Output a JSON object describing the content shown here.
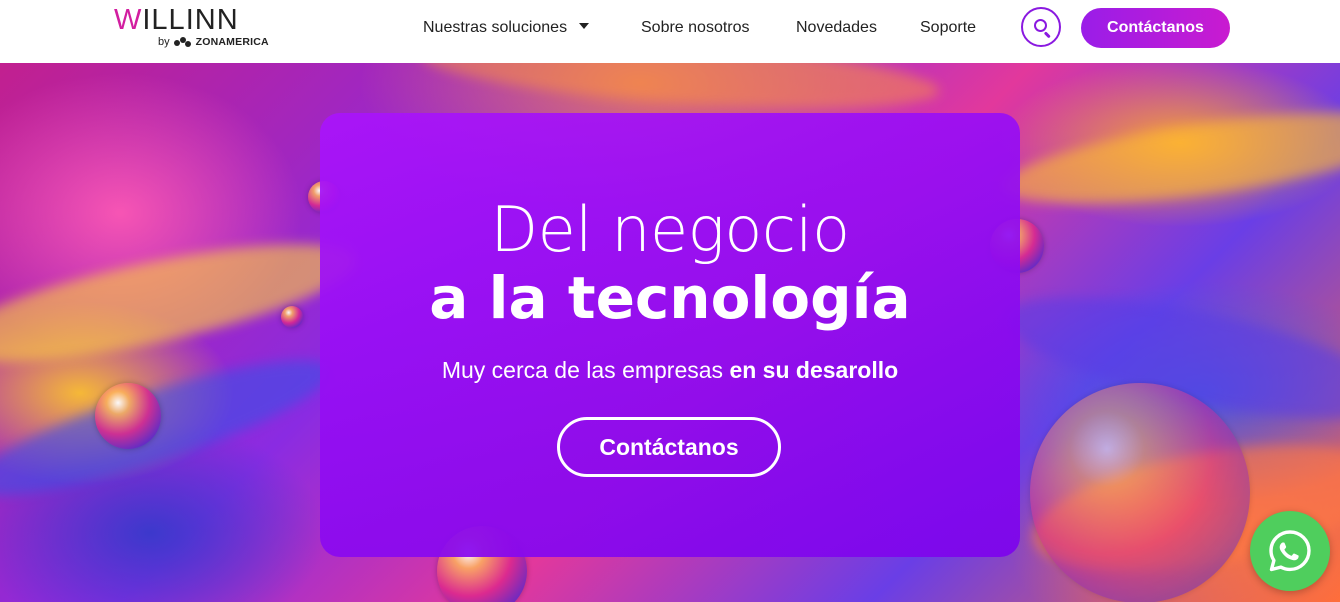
{
  "brand": {
    "logo_text": "WILLINN",
    "by_text": "by",
    "partner_text": "ZONAMERICA"
  },
  "nav": {
    "items": [
      {
        "label": "Nuestras soluciones",
        "has_dropdown": true
      },
      {
        "label": "Sobre nosotros"
      },
      {
        "label": "Novedades"
      },
      {
        "label": "Soporte"
      }
    ],
    "search_icon": "search-icon",
    "cta_label": "Contáctanos"
  },
  "hero": {
    "title_line1": "Del negocio",
    "title_line2": "a la tecnología",
    "subtitle_regular": "Muy cerca de las empresas ",
    "subtitle_bold": "en su desarollo",
    "cta_label": "Contáctanos"
  },
  "floating": {
    "whatsapp_icon": "whatsapp-icon"
  },
  "colors": {
    "accent": "#8a19e0",
    "cta_gradient_start": "#9a1de8",
    "cta_gradient_end": "#c91bd0",
    "card": "#9a10f0",
    "whatsapp": "#4fce5d",
    "logo_w": "#d21ea0"
  }
}
